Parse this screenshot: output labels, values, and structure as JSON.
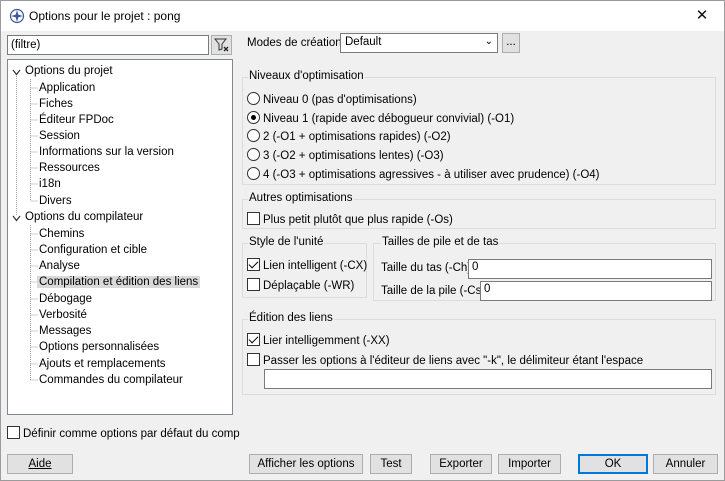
{
  "window": {
    "title": "Options pour le projet : pong",
    "close_label": "✕"
  },
  "filter": {
    "placeholder": "(filtre)"
  },
  "tree": {
    "root1": "Options du projet",
    "root1_children": [
      "Application",
      "Fiches",
      "Éditeur FPDoc",
      "Session",
      "Informations sur la version",
      "Ressources",
      "i18n",
      "Divers"
    ],
    "root2": "Options du compilateur",
    "root2_children": [
      "Chemins",
      "Configuration et cible",
      "Analyse",
      "Compilation et édition des liens",
      "Débogage",
      "Verbosité",
      "Messages",
      "Options personnalisées",
      "Ajouts et remplacements",
      "Commandes du compilateur"
    ],
    "selected_index": 3
  },
  "default_check": {
    "label": "Définir comme options par défaut du comp",
    "checked": false
  },
  "modes": {
    "label": "Modes de création",
    "value": "Default",
    "ellipsis": "..."
  },
  "optimization": {
    "title": "Niveaux d'optimisation",
    "options": [
      "Niveau 0 (pas d'optimisations)",
      "Niveau 1 (rapide avec débogueur convivial) (-O1)",
      "2 (-O1 + optimisations rapides) (-O2)",
      "3 (-O2 + optimisations lentes) (-O3)",
      "4 (-O3 + optimisations agressives - à utiliser avec prudence) (-O4)"
    ],
    "selected": 1
  },
  "other_opt": {
    "title": "Autres optimisations",
    "small_label": "Plus petit plutôt que plus rapide (-Os)",
    "small_checked": false
  },
  "unit_style": {
    "title": "Style de l'unité",
    "smart_label": "Lien intelligent (-CX)",
    "smart_checked": true,
    "relocatable_label": "Déplaçable (-WR)",
    "relocatable_checked": false
  },
  "stack_heap": {
    "title": "Tailles de pile et de tas",
    "heap_label": "Taille du tas (-Ch)",
    "heap_value": "0",
    "stack_label": "Taille de la pile (-Cs)",
    "stack_value": "0"
  },
  "linking": {
    "title": "Édition des liens",
    "smart_link_label": "Lier intelligemment (-XX)",
    "smart_link_checked": true,
    "pass_label": "Passer les options à l'éditeur de liens avec \"-k\", le délimiteur étant l'espace",
    "pass_checked": false,
    "pass_value": ""
  },
  "buttons": {
    "help": "Aide",
    "show_options": "Afficher les options",
    "test": "Test",
    "export": "Exporter",
    "import": "Importer",
    "ok": "OK",
    "cancel": "Annuler"
  }
}
